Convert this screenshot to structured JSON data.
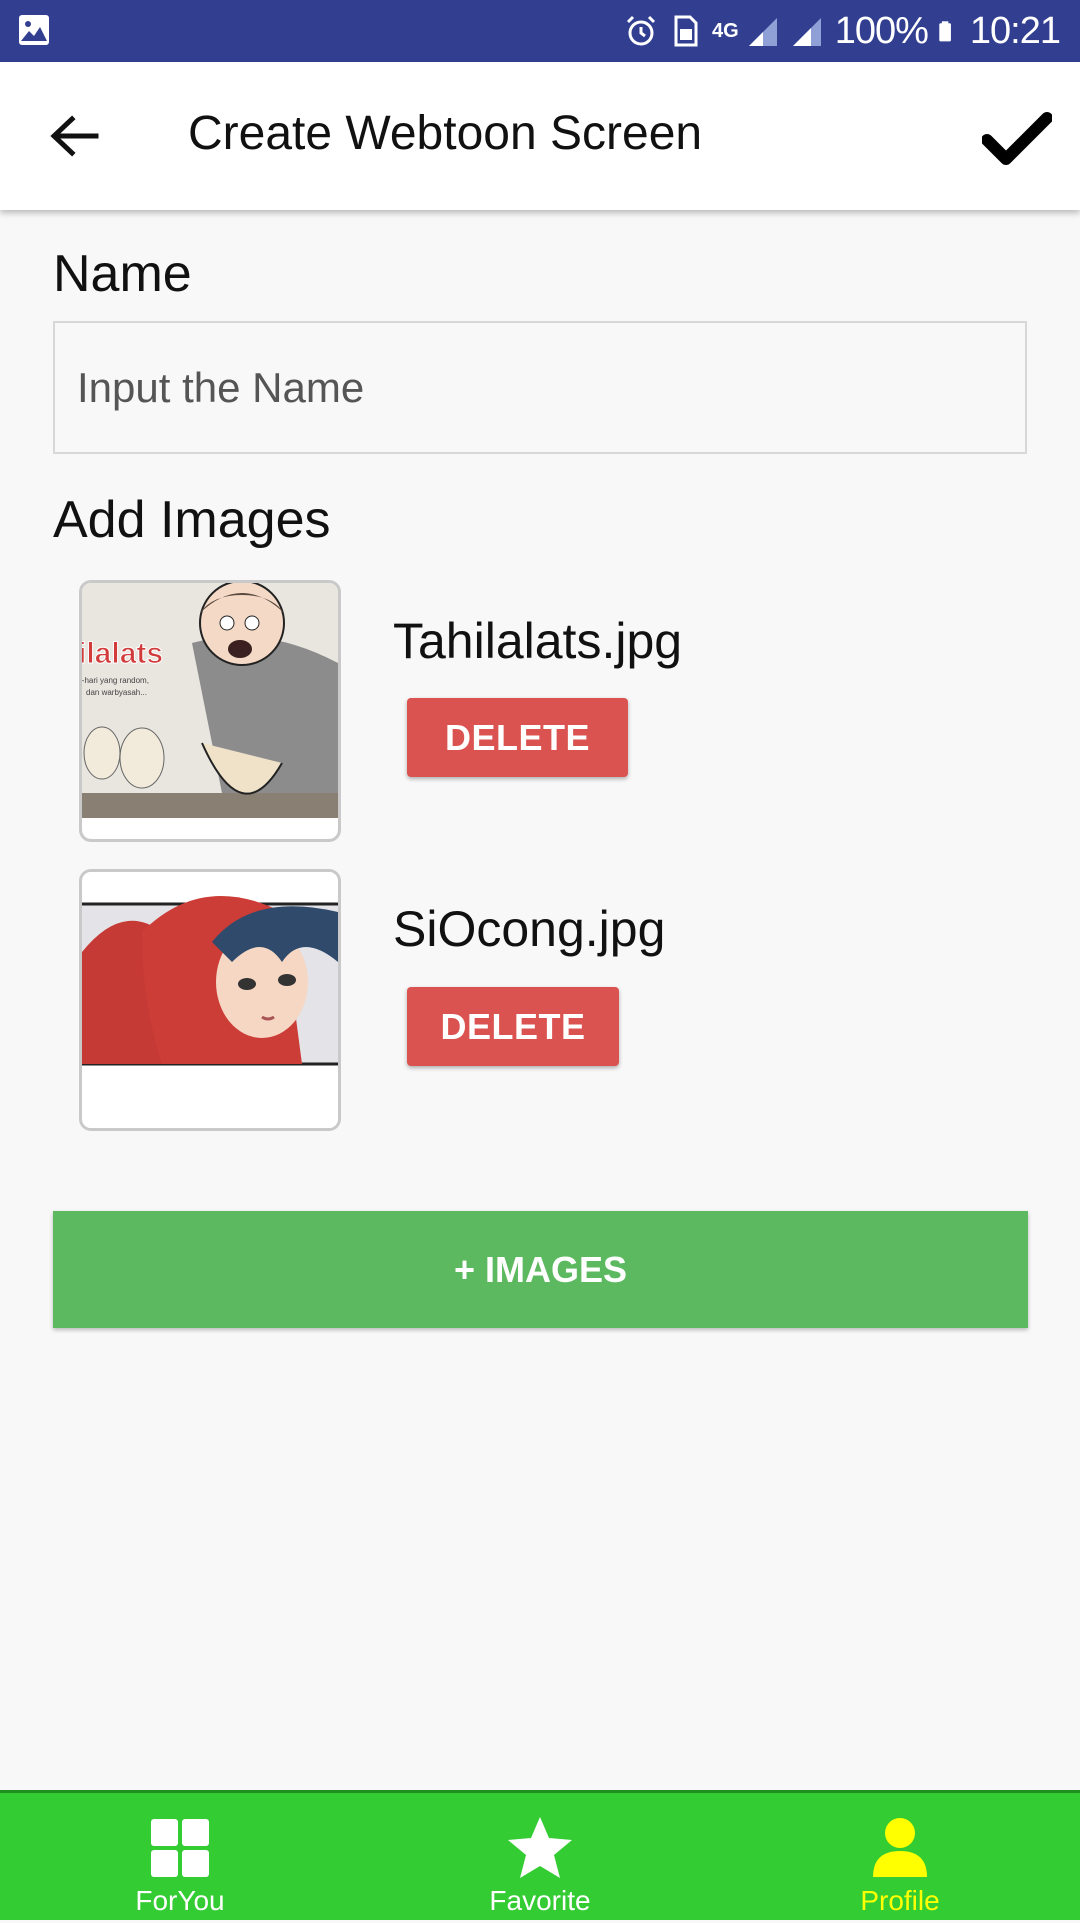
{
  "status_bar": {
    "network": "4G",
    "battery": "100%",
    "time": "10:21"
  },
  "app_bar": {
    "title": "Create Webtoon Screen",
    "icons": [
      "back-arrow-icon",
      "checkmark-icon"
    ]
  },
  "form": {
    "name_label": "Name",
    "name_placeholder": "Input the Name",
    "name_value": "",
    "images_label": "Add Images",
    "images": [
      {
        "filename": "Tahilalats.jpg",
        "delete_label": "DELETE",
        "thumb_text": "ilalats",
        "thumb_sub": "i-hari yang random,\ndan warbyasah..."
      },
      {
        "filename": "SiOcong.jpg",
        "delete_label": "DELETE"
      }
    ],
    "add_images_label": "+ IMAGES"
  },
  "bottom_nav": {
    "items": [
      {
        "label": "ForYou",
        "icon": "grid-icon",
        "active": false
      },
      {
        "label": "Favorite",
        "icon": "star-icon",
        "active": false
      },
      {
        "label": "Profile",
        "icon": "person-icon",
        "active": true
      }
    ]
  },
  "colors": {
    "status_bar": "#323f91",
    "delete": "#db5350",
    "add_images": "#5cb960",
    "bottom_nav": "#33cc33",
    "nav_active": "#ffff00"
  }
}
